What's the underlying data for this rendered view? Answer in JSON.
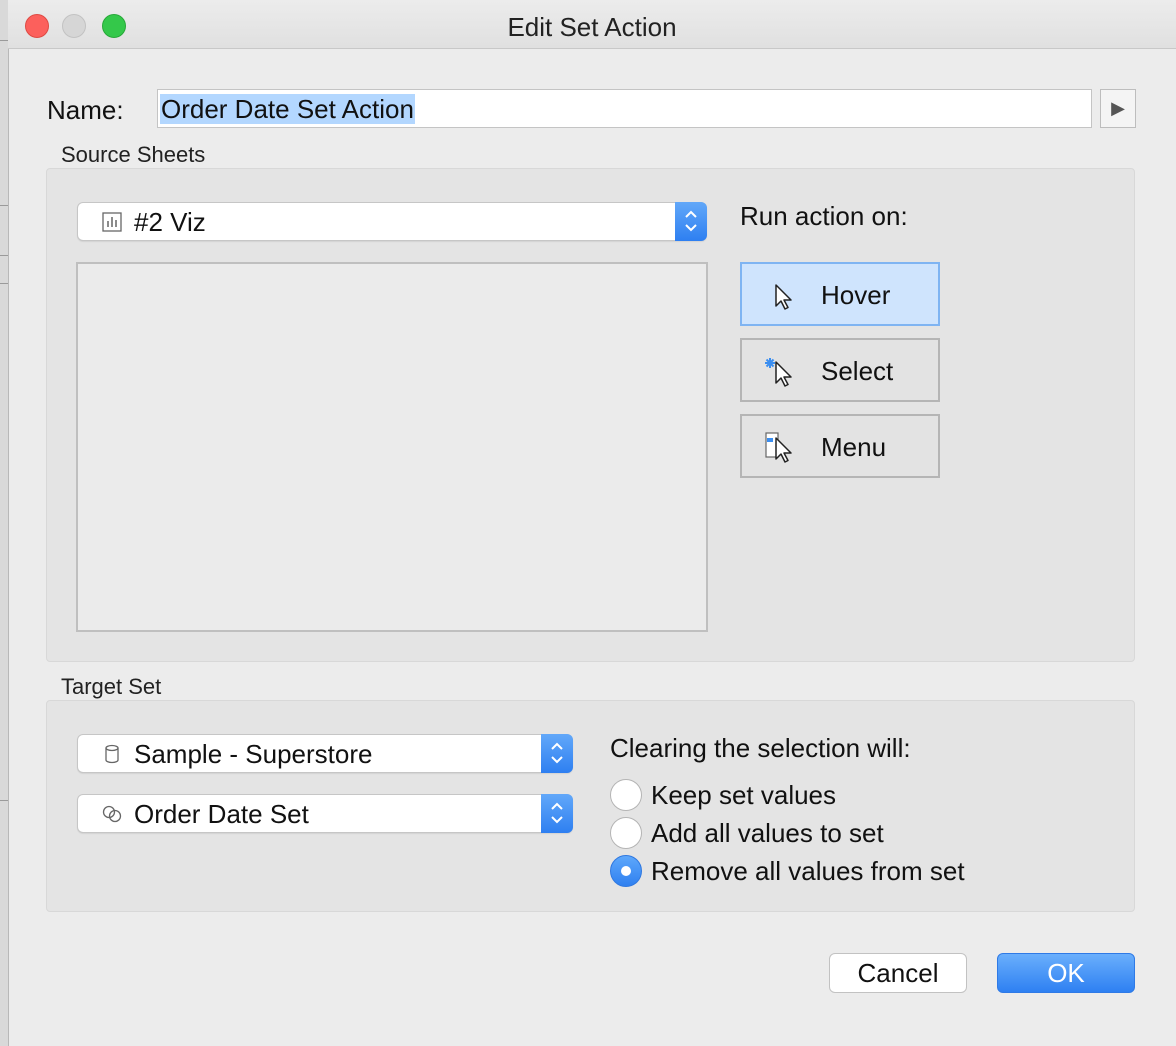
{
  "window": {
    "title": "Edit Set Action"
  },
  "name": {
    "label": "Name:",
    "value": "Order Date Set Action"
  },
  "source": {
    "heading": "Source Sheets",
    "sheet_select": {
      "value": "#2 Viz",
      "icon": "bar-chart-icon"
    },
    "run_label": "Run action on:",
    "actions": [
      {
        "label": "Hover",
        "icon": "hover-cursor-icon",
        "selected": true
      },
      {
        "label": "Select",
        "icon": "select-cursor-icon",
        "selected": false
      },
      {
        "label": "Menu",
        "icon": "menu-cursor-icon",
        "selected": false
      }
    ]
  },
  "target": {
    "heading": "Target Set",
    "datasource_select": {
      "value": "Sample - Superstore",
      "icon": "database-icon"
    },
    "set_select": {
      "value": "Order Date Set",
      "icon": "set-icon"
    },
    "clearing_label": "Clearing the selection will:",
    "options": [
      {
        "label": "Keep set values",
        "selected": false
      },
      {
        "label": "Add all values to set",
        "selected": false
      },
      {
        "label": "Remove all values from set",
        "selected": true
      }
    ]
  },
  "buttons": {
    "cancel": "Cancel",
    "ok": "OK"
  },
  "colors": {
    "accent": "#2e80f2",
    "selection": "#b3d7ff",
    "hover_active": "#cfe4fd"
  }
}
